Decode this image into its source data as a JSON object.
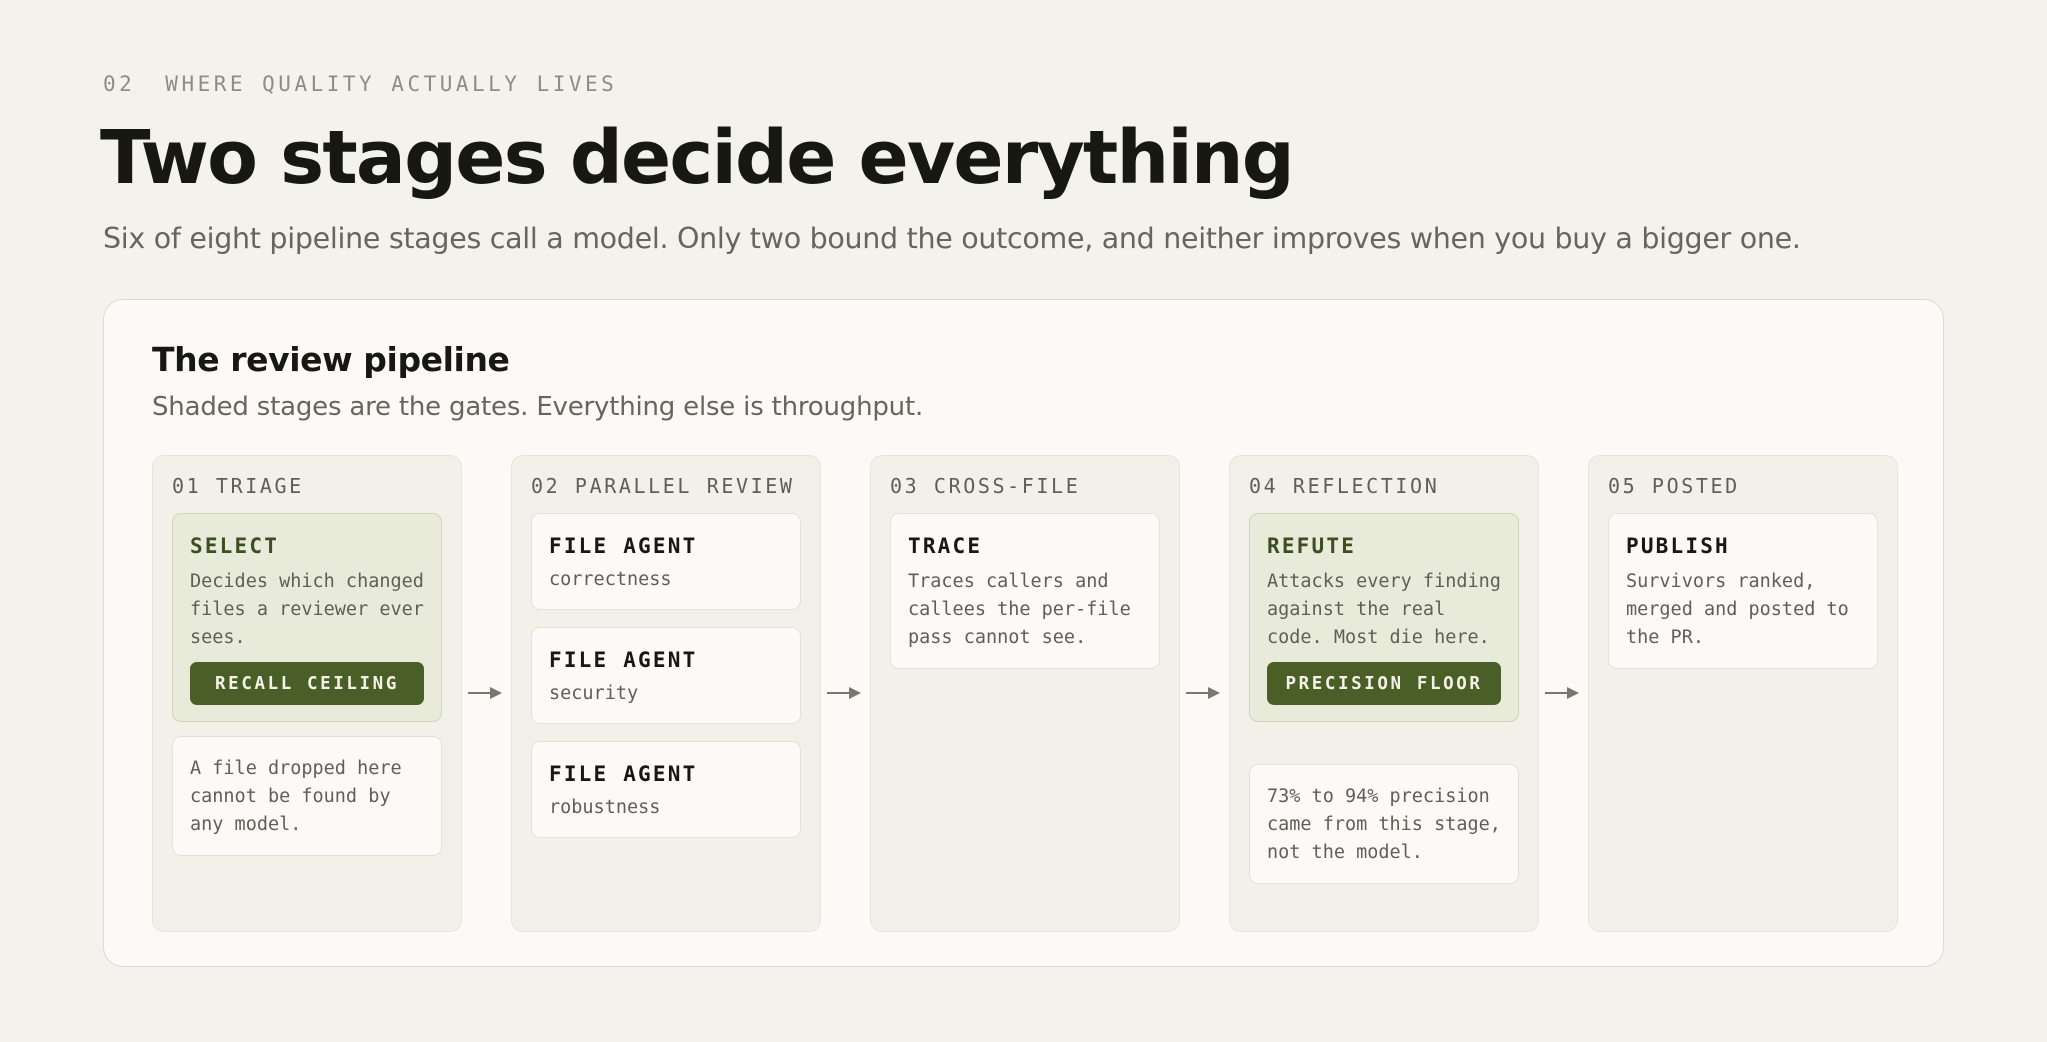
{
  "section": {
    "number": "02",
    "label": "WHERE QUALITY ACTUALLY LIVES"
  },
  "headline": "Two stages decide everything",
  "subhead": "Six of eight pipeline stages call a model. Only two bound the outcome, and neither improves when you buy a bigger one.",
  "panel": {
    "title": "The review pipeline",
    "subtitle": "Shaded stages are the gates. Everything else is throughput."
  },
  "stages": [
    {
      "label": "01 TRIAGE",
      "cards": [
        {
          "title": "SELECT",
          "text": "Decides which changed files a reviewer ever sees.",
          "badge": "RECALL CEILING",
          "gate": true
        },
        {
          "text": "A file dropped here cannot be found by any model."
        }
      ]
    },
    {
      "label": "02 PARALLEL REVIEW",
      "cards": [
        {
          "title": "FILE AGENT",
          "text": "correctness"
        },
        {
          "title": "FILE AGENT",
          "text": "security"
        },
        {
          "title": "FILE AGENT",
          "text": "robustness"
        }
      ]
    },
    {
      "label": "03 CROSS-FILE",
      "cards": [
        {
          "title": "TRACE",
          "text": "Traces callers and callees the per-file pass cannot see."
        }
      ]
    },
    {
      "label": "04 REFLECTION",
      "cards": [
        {
          "title": "REFUTE",
          "text": "Attacks every finding against the real code. Most die here.",
          "badge": "PRECISION FLOOR",
          "gate": true
        },
        {
          "text": "73% to 94% precision came from this stage, not the model."
        }
      ]
    },
    {
      "label": "05 POSTED",
      "cards": [
        {
          "title": "PUBLISH",
          "text": "Survivors ranked, merged and posted to the PR."
        }
      ]
    }
  ],
  "colors": {
    "background": "#f3f2ed",
    "panel": "#fbfaf6",
    "stage": "#f1f0e9",
    "gate_card": "#e8ebda",
    "badge": "#4a5e28",
    "gate_title": "#3d4f22"
  },
  "icons": {
    "connector": "right-arrow-icon"
  }
}
